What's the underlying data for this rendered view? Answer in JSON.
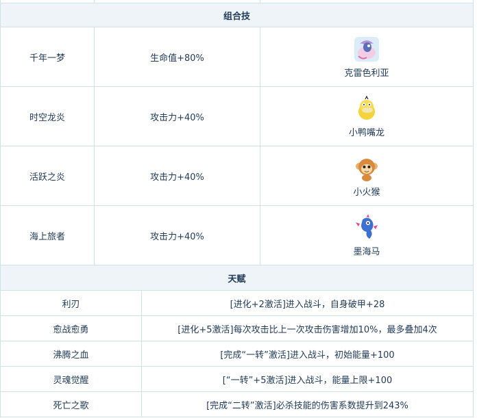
{
  "combo": {
    "header": "组合技",
    "rows": [
      {
        "skill": "千年一梦",
        "effect": "生命值+80%",
        "pet": "克雷色利亚",
        "icon": "cresselia-icon"
      },
      {
        "skill": "时空龙炎",
        "effect": "攻击力+40%",
        "pet": "小鸭嘴龙",
        "icon": "psyduck-icon"
      },
      {
        "skill": "活跃之炎",
        "effect": "攻击力+40%",
        "pet": "小火猴",
        "icon": "chimchar-icon"
      },
      {
        "skill": "海上旅者",
        "effect": "攻击力+40%",
        "pet": "墨海马",
        "icon": "horsea-icon"
      }
    ]
  },
  "talent": {
    "header": "天赋",
    "rows": [
      {
        "name": "利刃",
        "desc": "[进化+2激活]进入战斗，自身破甲+28"
      },
      {
        "name": "愈战愈勇",
        "desc": "[进化+5激活]每次攻击比上一次攻击伤害增加10%，最多叠加4次"
      },
      {
        "name": "沸腾之血",
        "desc": "[完成“一转”激活]进入战斗，初始能量+100"
      },
      {
        "name": "灵魂觉醒",
        "desc": "[“一转”+5激活]进入战斗，能量上限+100"
      },
      {
        "name": "死亡之歌",
        "desc": "[完成“二转”激活]必杀技能的伤害系数提升到243%"
      }
    ]
  }
}
